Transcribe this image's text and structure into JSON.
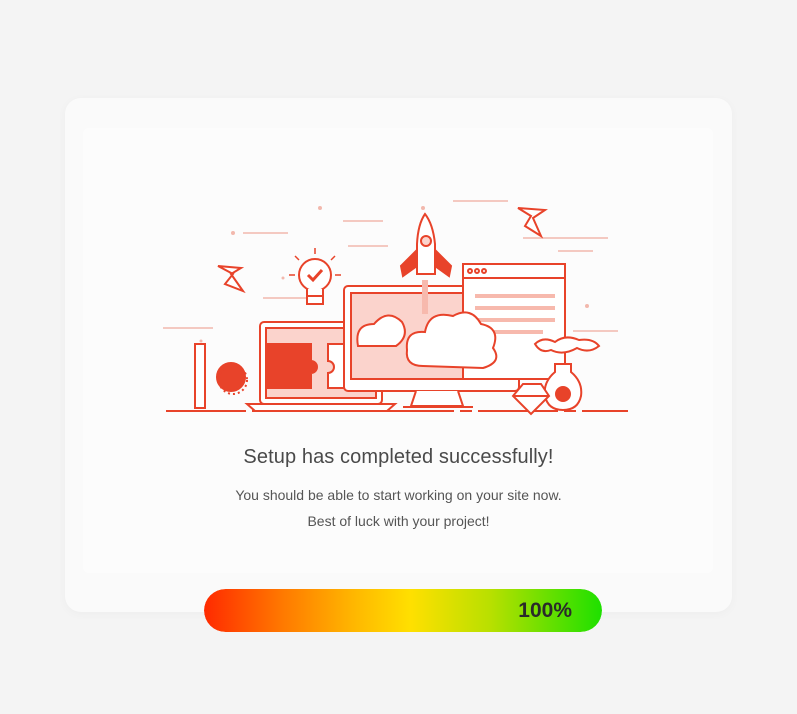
{
  "completion": {
    "title": "Setup has completed successfully!",
    "message_line1": "You should be able to start working on your site now.",
    "message_line2": "Best of luck with your project!"
  },
  "progress": {
    "value": 1.0,
    "label": "100%"
  },
  "illustration": {
    "name": "setup-complete-illustration",
    "accent_color": "#e8432a",
    "light_color": "#fbd3cc"
  }
}
